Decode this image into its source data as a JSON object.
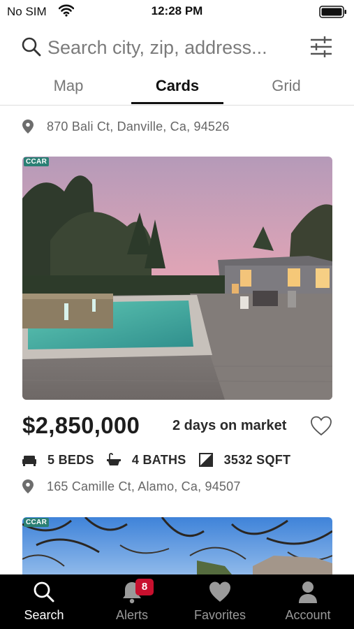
{
  "status_bar": {
    "carrier": "No SIM",
    "time": "12:28 PM",
    "icons": [
      "wifi-icon",
      "battery-icon"
    ]
  },
  "search": {
    "placeholder": "Search city, zip, address...",
    "icons": [
      "search-icon",
      "filter-icon"
    ]
  },
  "tabs": [
    {
      "label": "Map",
      "active": false
    },
    {
      "label": "Cards",
      "active": true
    },
    {
      "label": "Grid",
      "active": false
    }
  ],
  "listings": [
    {
      "address": "870 Bali Ct, Danville, Ca, 94526"
    },
    {
      "badge": "CCAR",
      "price": "$2,850,000",
      "days_on_market": "2 days on market",
      "beds": "5 BEDS",
      "baths": "4 BATHS",
      "sqft": "3532 SQFT",
      "address": "165 Camille Ct, Alamo, Ca, 94507",
      "favorite": false
    },
    {
      "badge": "CCAR"
    }
  ],
  "bottom_nav": [
    {
      "label": "Search",
      "icon": "search-icon",
      "active": true
    },
    {
      "label": "Alerts",
      "icon": "bell-icon",
      "badge": "8",
      "active": false
    },
    {
      "label": "Favorites",
      "icon": "heart-icon",
      "active": false
    },
    {
      "label": "Account",
      "icon": "person-icon",
      "active": false
    }
  ],
  "colors": {
    "accent_badge": "#c8102e",
    "ccar_badge": "#2a7f74",
    "nav_background": "#000000"
  }
}
